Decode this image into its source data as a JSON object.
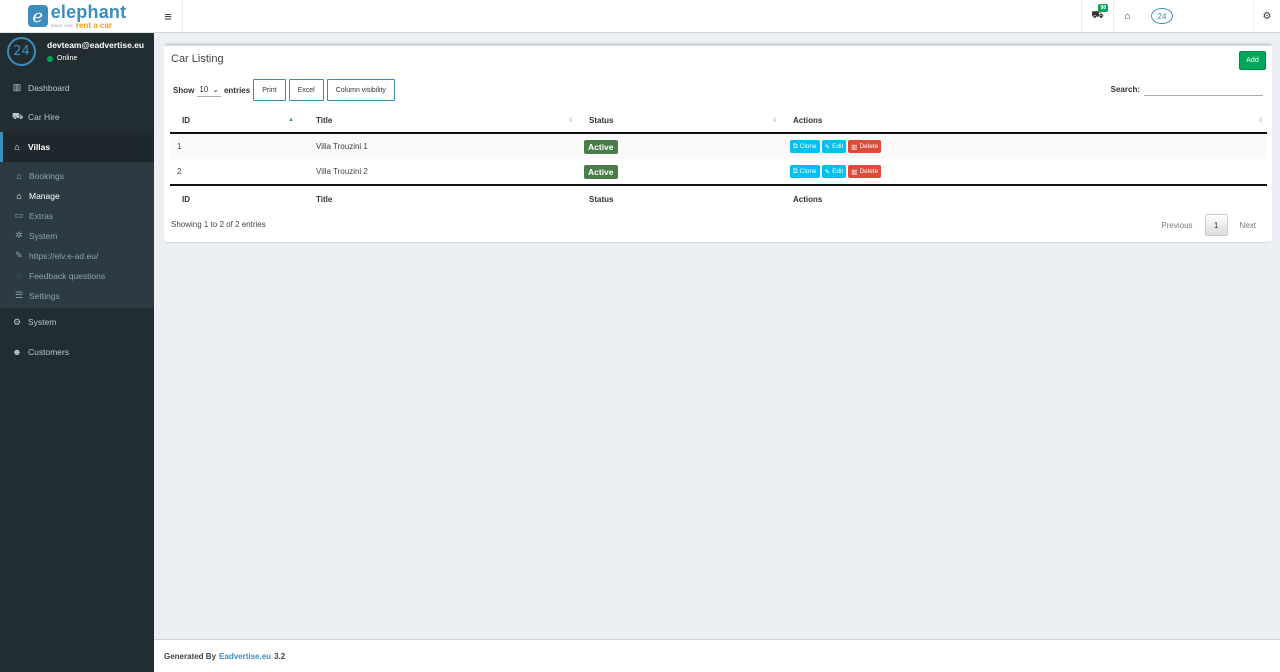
{
  "logo": {
    "mark": "e",
    "name": "elephant",
    "since": "SINCE 1982",
    "tagline": "rent a car"
  },
  "user": {
    "avatar_text": "24",
    "email": "devteam@eadvertise.eu",
    "status": "Online"
  },
  "sidebar": {
    "items": [
      {
        "label": "Dashboard",
        "icon": "bar-chart-icon"
      },
      {
        "label": "Car Hire",
        "icon": "car-icon"
      },
      {
        "label": "Villas",
        "icon": "home-icon"
      }
    ],
    "sub_items": [
      {
        "label": "Bookings",
        "icon": "home-icon"
      },
      {
        "label": "Manage",
        "icon": "home-icon"
      },
      {
        "label": "Extras",
        "icon": "keyboard-icon"
      },
      {
        "label": "System",
        "icon": "gear-icon"
      },
      {
        "label": "https://elv.e-ad.eu/",
        "icon": "wrench-icon"
      },
      {
        "label": "Feedback questions",
        "icon": "comment-icon"
      },
      {
        "label": "Settings",
        "icon": "list-icon"
      }
    ],
    "bottom_items": [
      {
        "label": "System",
        "icon": "gears-icon"
      },
      {
        "label": "Customers",
        "icon": "users-icon"
      }
    ]
  },
  "header": {
    "notification_count": "98",
    "brand_24": "24"
  },
  "box": {
    "title": "Car Listing",
    "add_label": "Add",
    "show_label": "Show",
    "entries_value": "10",
    "entries_label": "entries",
    "buttons": [
      "Print",
      "Excel",
      "Column visibility"
    ],
    "search_label": "Search:",
    "search_value": ""
  },
  "table": {
    "columns": [
      "ID",
      "Title",
      "Status",
      "Actions"
    ],
    "rows": [
      {
        "id": "1",
        "title": "Villa Trouzini 1",
        "status": "Active"
      },
      {
        "id": "2",
        "title": "Villa Trouzini 2",
        "status": "Active"
      }
    ],
    "actions": {
      "clone": "Clone",
      "edit": "Edit",
      "delete": "Delete"
    },
    "info": "Showing 1 to 2 of 2 entries",
    "pagination": {
      "previous": "Previous",
      "current": "1",
      "next": "Next"
    }
  },
  "footer": {
    "prefix": "Generated By",
    "link": "Eadvertise.eu",
    "version": "3.2"
  },
  "colors": {
    "accent": "#3c8dbc",
    "success": "#00a65a",
    "info": "#00c0ef",
    "danger": "#dd4b39",
    "sidebar": "#222d32"
  }
}
